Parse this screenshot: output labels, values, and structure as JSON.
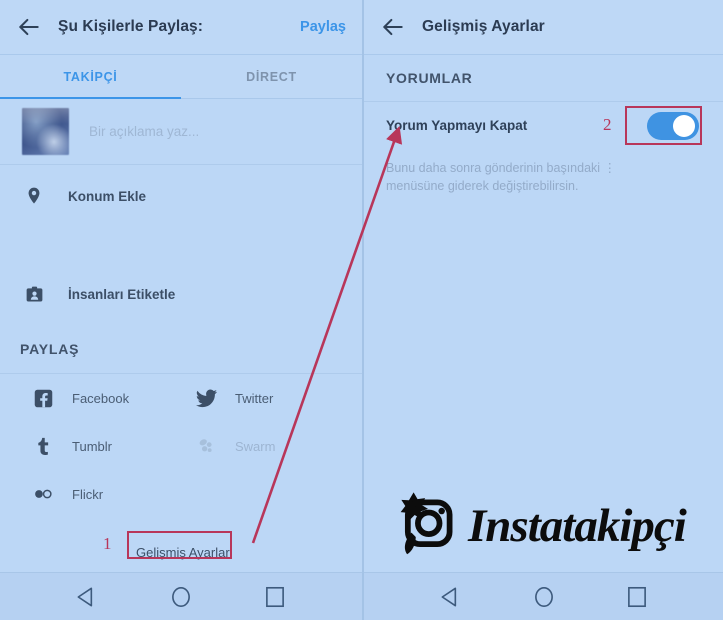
{
  "left_panel": {
    "appbar": {
      "back_icon": "arrow-left-icon",
      "title": "Şu Kişilerle Paylaş:",
      "action": "Paylaş"
    },
    "tabs": [
      {
        "label": "TAKİPÇİ",
        "active": true
      },
      {
        "label": "DİRECT",
        "active": false
      }
    ],
    "caption": {
      "thumbnail": "post-thumbnail",
      "placeholder": "Bir açıklama yaz..."
    },
    "options": [
      {
        "icon": "location-pin-icon",
        "label": "Konum Ekle"
      },
      {
        "icon": "tag-people-icon",
        "label": "İnsanları Etiketle"
      }
    ],
    "share_section": {
      "heading": "PAYLAŞ",
      "items": [
        {
          "icon": "facebook-icon",
          "label": "Facebook",
          "disabled": false
        },
        {
          "icon": "twitter-icon",
          "label": "Twitter",
          "disabled": false
        },
        {
          "icon": "tumblr-icon",
          "label": "Tumblr",
          "disabled": false
        },
        {
          "icon": "swarm-icon",
          "label": "Swarm",
          "disabled": true
        },
        {
          "icon": "flickr-icon",
          "label": "Flickr",
          "disabled": false
        }
      ]
    },
    "advanced_button": "Gelişmiş Ayarlar"
  },
  "right_panel": {
    "appbar": {
      "back_icon": "arrow-left-icon",
      "title": "Gelişmiş Ayarlar"
    },
    "section_title": "YORUMLAR",
    "switch_row": {
      "label": "Yorum Yapmayı Kapat",
      "state": "on"
    },
    "description": "Bunu daha sonra gönderinin başındaki ⋮ menüsüne giderek değiştirebilirsin."
  },
  "navbar": {
    "back": "nav-back-triangle-icon",
    "home": "nav-home-circle-icon",
    "recents": "nav-recents-square-icon"
  },
  "annotations": {
    "step_one": "1",
    "step_two": "2",
    "highlight_color": "#b8365a"
  },
  "watermark": {
    "icon": "instagram-camera-star-icon",
    "text": "Instatakipçi"
  }
}
